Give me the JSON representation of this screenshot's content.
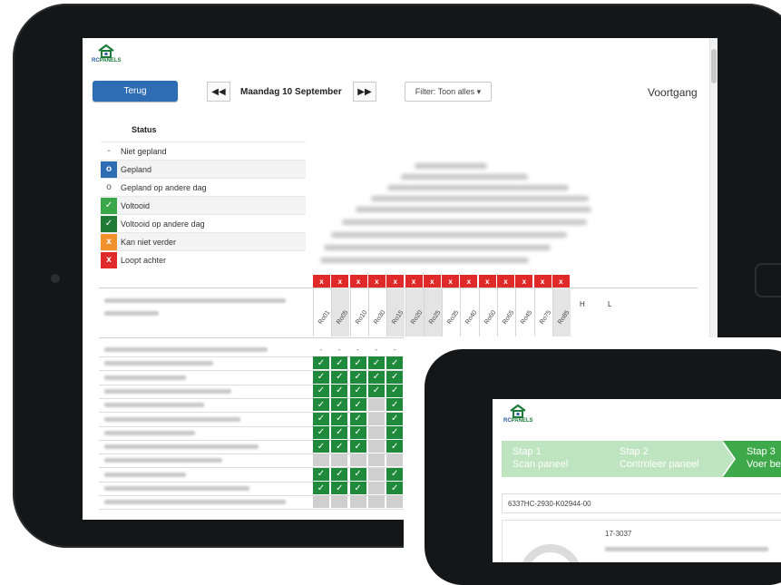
{
  "app": {
    "brand": "RCPANELS",
    "brand_prefix": "RC",
    "brand_suffix": "PANELS",
    "colors": {
      "primary": "#2e6db4",
      "success": "#1f8a3b",
      "danger": "#e02a2a",
      "warning": "#f0912b",
      "brand_green": "#1d7a3a"
    }
  },
  "toolbar": {
    "back_label": "Terug",
    "prev_label": "◀◀",
    "date_label": "Maandag 10 September",
    "next_label": "▶▶",
    "filter_label": "Filter: Toon alles ▾",
    "progress_label": "Voortgang"
  },
  "legend": {
    "title": "Status",
    "items": [
      {
        "icon": "dash-icon",
        "symbol": "-",
        "label": "Niet gepland",
        "color": "#ffffff"
      },
      {
        "icon": "circle-filled-icon",
        "symbol": "o",
        "label": "Gepland",
        "color": "#2e6db4"
      },
      {
        "icon": "circle-outline-icon",
        "symbol": "o",
        "label": "Gepland op andere dag",
        "color": "#ffffff"
      },
      {
        "icon": "check-icon",
        "symbol": "✓",
        "label": "Voltooid",
        "color": "#3aa64a"
      },
      {
        "icon": "check-icon",
        "symbol": "✓",
        "label": "Voltooid op andere dag",
        "color": "#1f7a36"
      },
      {
        "icon": "x-icon",
        "symbol": "x",
        "label": "Kan niet verder",
        "color": "#f0912b"
      },
      {
        "icon": "x-icon",
        "symbol": "x",
        "label": "Loopt achter",
        "color": "#e02a2a"
      }
    ]
  },
  "table": {
    "column_alert_symbol": "x",
    "columns": [
      "Ro01",
      "Ro05",
      "Ro10",
      "Ro30",
      "Ro15",
      "Ro20",
      "Ro25",
      "Ro35",
      "Ro40",
      "Ro60",
      "Ro65",
      "Ro45",
      "Ro75",
      "Ro85"
    ],
    "extra_headers": [
      "H",
      "L"
    ],
    "placeholder_symbol": "-",
    "check_symbol": "✓"
  },
  "wizard": {
    "brand": "RCPANELS",
    "steps": [
      {
        "title": "Stap 1",
        "subtitle": "Scan paneel"
      },
      {
        "title": "Stap 2",
        "subtitle": "Controleer paneel"
      },
      {
        "title": "Stap 3",
        "subtitle": "Voer be"
      }
    ],
    "panel_code": "6337HC-2930-K02944-00",
    "panel_number": "17-3037"
  }
}
